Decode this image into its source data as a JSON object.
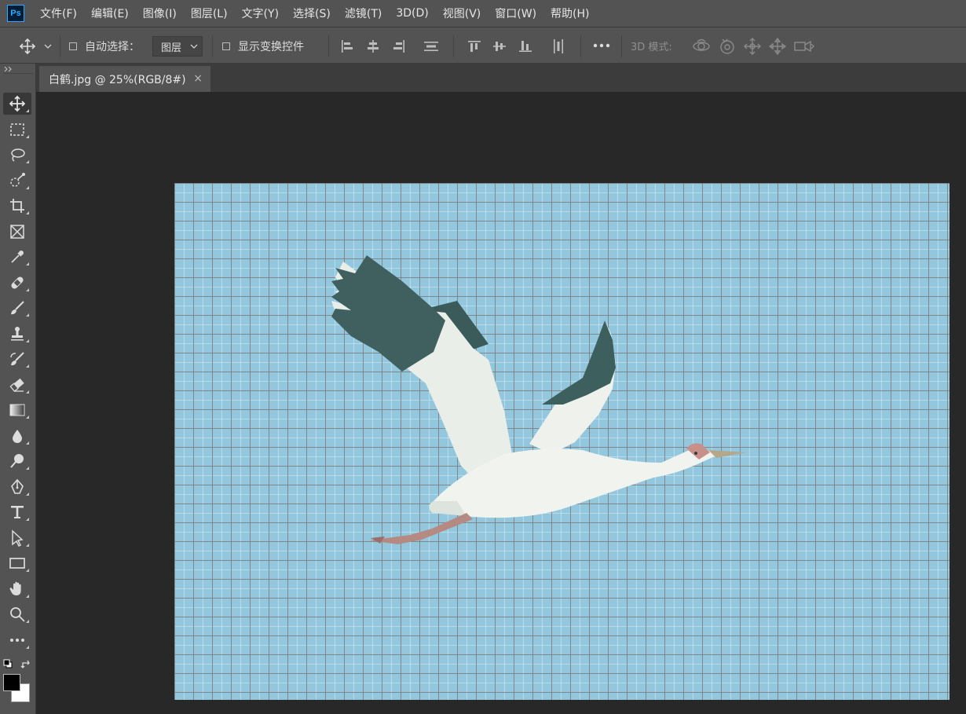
{
  "app": {
    "logo_text": "Ps",
    "accent_color": "#31a8ff"
  },
  "menu": {
    "items": [
      "文件(F)",
      "编辑(E)",
      "图像(I)",
      "图层(L)",
      "文字(Y)",
      "选择(S)",
      "滤镜(T)",
      "3D(D)",
      "视图(V)",
      "窗口(W)",
      "帮助(H)"
    ]
  },
  "options": {
    "auto_select_label": "自动选择：",
    "auto_select_checked": false,
    "layer_dropdown_value": "图层",
    "show_transform_label": "显示变换控件",
    "show_transform_checked": false,
    "mode_3d_label": "3D 模式:"
  },
  "document": {
    "tab_title": "白鹤.jpg @ 25%(RGB/8#)",
    "close_glyph": "×",
    "zoom": "25%",
    "canvas_color": "#93c7dd",
    "grid_visible": true
  },
  "toolbar": {
    "active_tool": "move",
    "tools": [
      "move",
      "marquee",
      "lasso",
      "quick-selection",
      "crop",
      "frame",
      "eyedropper",
      "healing-brush",
      "brush",
      "clone-stamp",
      "history-brush",
      "eraser",
      "gradient",
      "blur",
      "dodge",
      "pen",
      "type",
      "path-selection",
      "rectangle",
      "hand",
      "zoom",
      "more"
    ],
    "foreground_color": "#000000",
    "background_color": "#ffffff"
  }
}
